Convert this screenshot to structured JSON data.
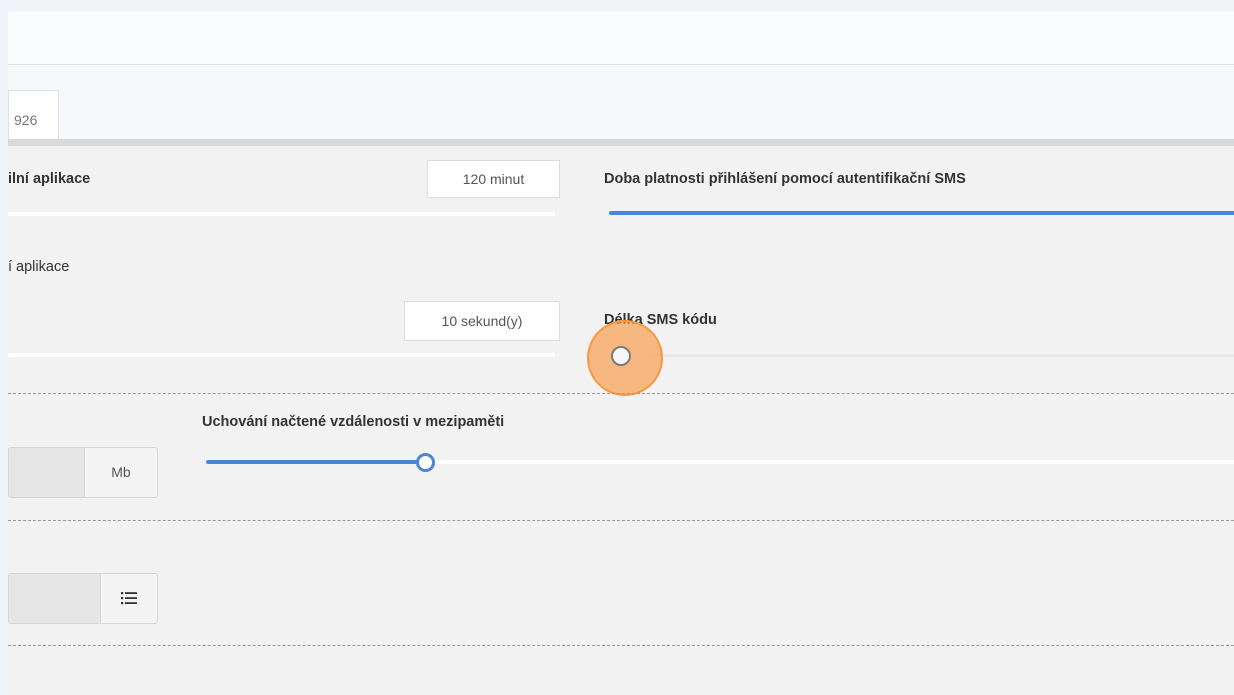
{
  "tabs": {
    "active_label": "926"
  },
  "settings": {
    "app_timeout": {
      "label": "ilní aplikace",
      "value": "120 minut"
    },
    "sms_validity": {
      "label": "Doba platnosti přihlášení pomocí autentifikační SMS"
    },
    "app_interval": {
      "label": "í aplikace",
      "value": "10 sekund(y)"
    },
    "sms_code_length": {
      "label": "Délka SMS kódu"
    },
    "cache": {
      "unit": "Mb",
      "label": "Uchování načtené vzdálenosti v mezipaměti"
    },
    "list_field": {
      "icon": "list-icon"
    }
  },
  "colors": {
    "accent": "#4a86d4",
    "highlight": "#f7a04f"
  }
}
